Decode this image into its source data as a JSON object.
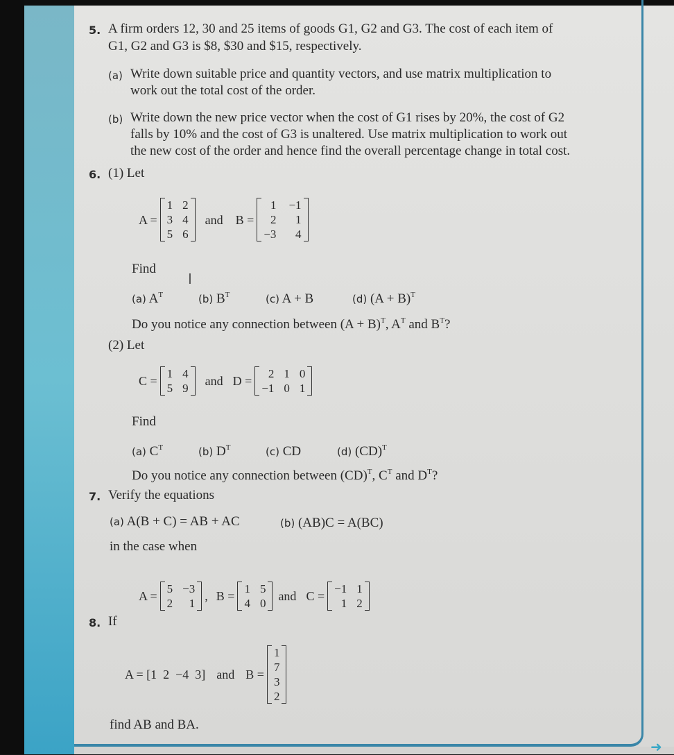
{
  "questions": {
    "q5": {
      "number": "5.",
      "text_line1": "A firm orders 12, 30 and 25 items of goods G1, G2 and G3. The cost of each item of",
      "text_line2": "G1, G2 and G3 is $8, $30 and $15, respectively.",
      "a_label": "(a)",
      "a_line1": "Write down suitable price and quantity vectors, and use matrix multiplication to",
      "a_line2": "work out the total cost of the order.",
      "b_label": "(b)",
      "b_line1": "Write down the new price vector when the cost of G1 rises by 20%, the cost of G2",
      "b_line2": "falls by 10% and the cost of G3 is unaltered. Use matrix multiplication to work out",
      "b_line3": "the new cost of the order and hence find the overall percentage change in total cost."
    },
    "q6": {
      "number": "6.",
      "part1_label": "(1) Let",
      "matA_name": "A =",
      "matA": [
        [
          "1",
          "2"
        ],
        [
          "3",
          "4"
        ],
        [
          "5",
          "6"
        ]
      ],
      "and1": "and",
      "matB_name": "B =",
      "matB": [
        [
          "1",
          "−1"
        ],
        [
          "2",
          "1"
        ],
        [
          "−3",
          "4"
        ]
      ],
      "find1": "Find",
      "items1": [
        {
          "label": "(a)",
          "expr": "A",
          "sup": "T"
        },
        {
          "label": "(b)",
          "expr": "B",
          "sup": "T"
        },
        {
          "label": "(c)",
          "expr": "A + B",
          "sup": ""
        },
        {
          "label": "(d)",
          "expr": "(A + B)",
          "sup": "T"
        }
      ],
      "notice1_pre": "Do you notice any connection between (A + B)",
      "notice1_mid1": ", A",
      "notice1_mid2": " and B",
      "notice1_end": "?",
      "sup_T": "T",
      "part2_label": "(2) Let",
      "matC_name": "C =",
      "matC": [
        [
          "1",
          "4"
        ],
        [
          "5",
          "9"
        ]
      ],
      "and2": "and",
      "matD_name": "D =",
      "matD": [
        [
          "2",
          "1",
          "0"
        ],
        [
          "−1",
          "0",
          "1"
        ]
      ],
      "find2": "Find",
      "items2": [
        {
          "label": "(a)",
          "expr": "C",
          "sup": "T"
        },
        {
          "label": "(b)",
          "expr": "D",
          "sup": "T"
        },
        {
          "label": "(c)",
          "expr": "CD",
          "sup": ""
        },
        {
          "label": "(d)",
          "expr": "(CD)",
          "sup": "T"
        }
      ],
      "notice2_pre": "Do you notice any connection between (CD)",
      "notice2_mid1": ", C",
      "notice2_mid2": " and D",
      "notice2_end": "?"
    },
    "q7": {
      "number": "7.",
      "text": "Verify the equations",
      "a_label": "(a)",
      "a_expr": "A(B + C) = AB + AC",
      "b_label": "(b)",
      "b_expr": "(AB)C = A(BC)",
      "case_text": "in the case when",
      "matA_name": "A =",
      "matA": [
        [
          "5",
          "−3"
        ],
        [
          "2",
          "1"
        ]
      ],
      "sep": ",",
      "matB_name": "B =",
      "matB": [
        [
          "1",
          "5"
        ],
        [
          "4",
          "0"
        ]
      ],
      "and": "and",
      "matC_name": "C =",
      "matC": [
        [
          "−1",
          "1"
        ],
        [
          "1",
          "2"
        ]
      ]
    },
    "q8": {
      "number": "8.",
      "text": "If",
      "rowA": "A = [1  2  −4  3]",
      "and": "and",
      "matB_name": "B =",
      "matB": [
        [
          "1"
        ],
        [
          "7"
        ],
        [
          "3"
        ],
        [
          "2"
        ]
      ],
      "find_text": "find AB and BA."
    }
  },
  "icons": {
    "cursor": "I",
    "next_arrow": "➜"
  },
  "colors": {
    "page_bg": "#dfdfdd",
    "accent_teal": "#3a86a8",
    "strip_teal": "#6cbfd2",
    "text": "#2a2a2a"
  }
}
